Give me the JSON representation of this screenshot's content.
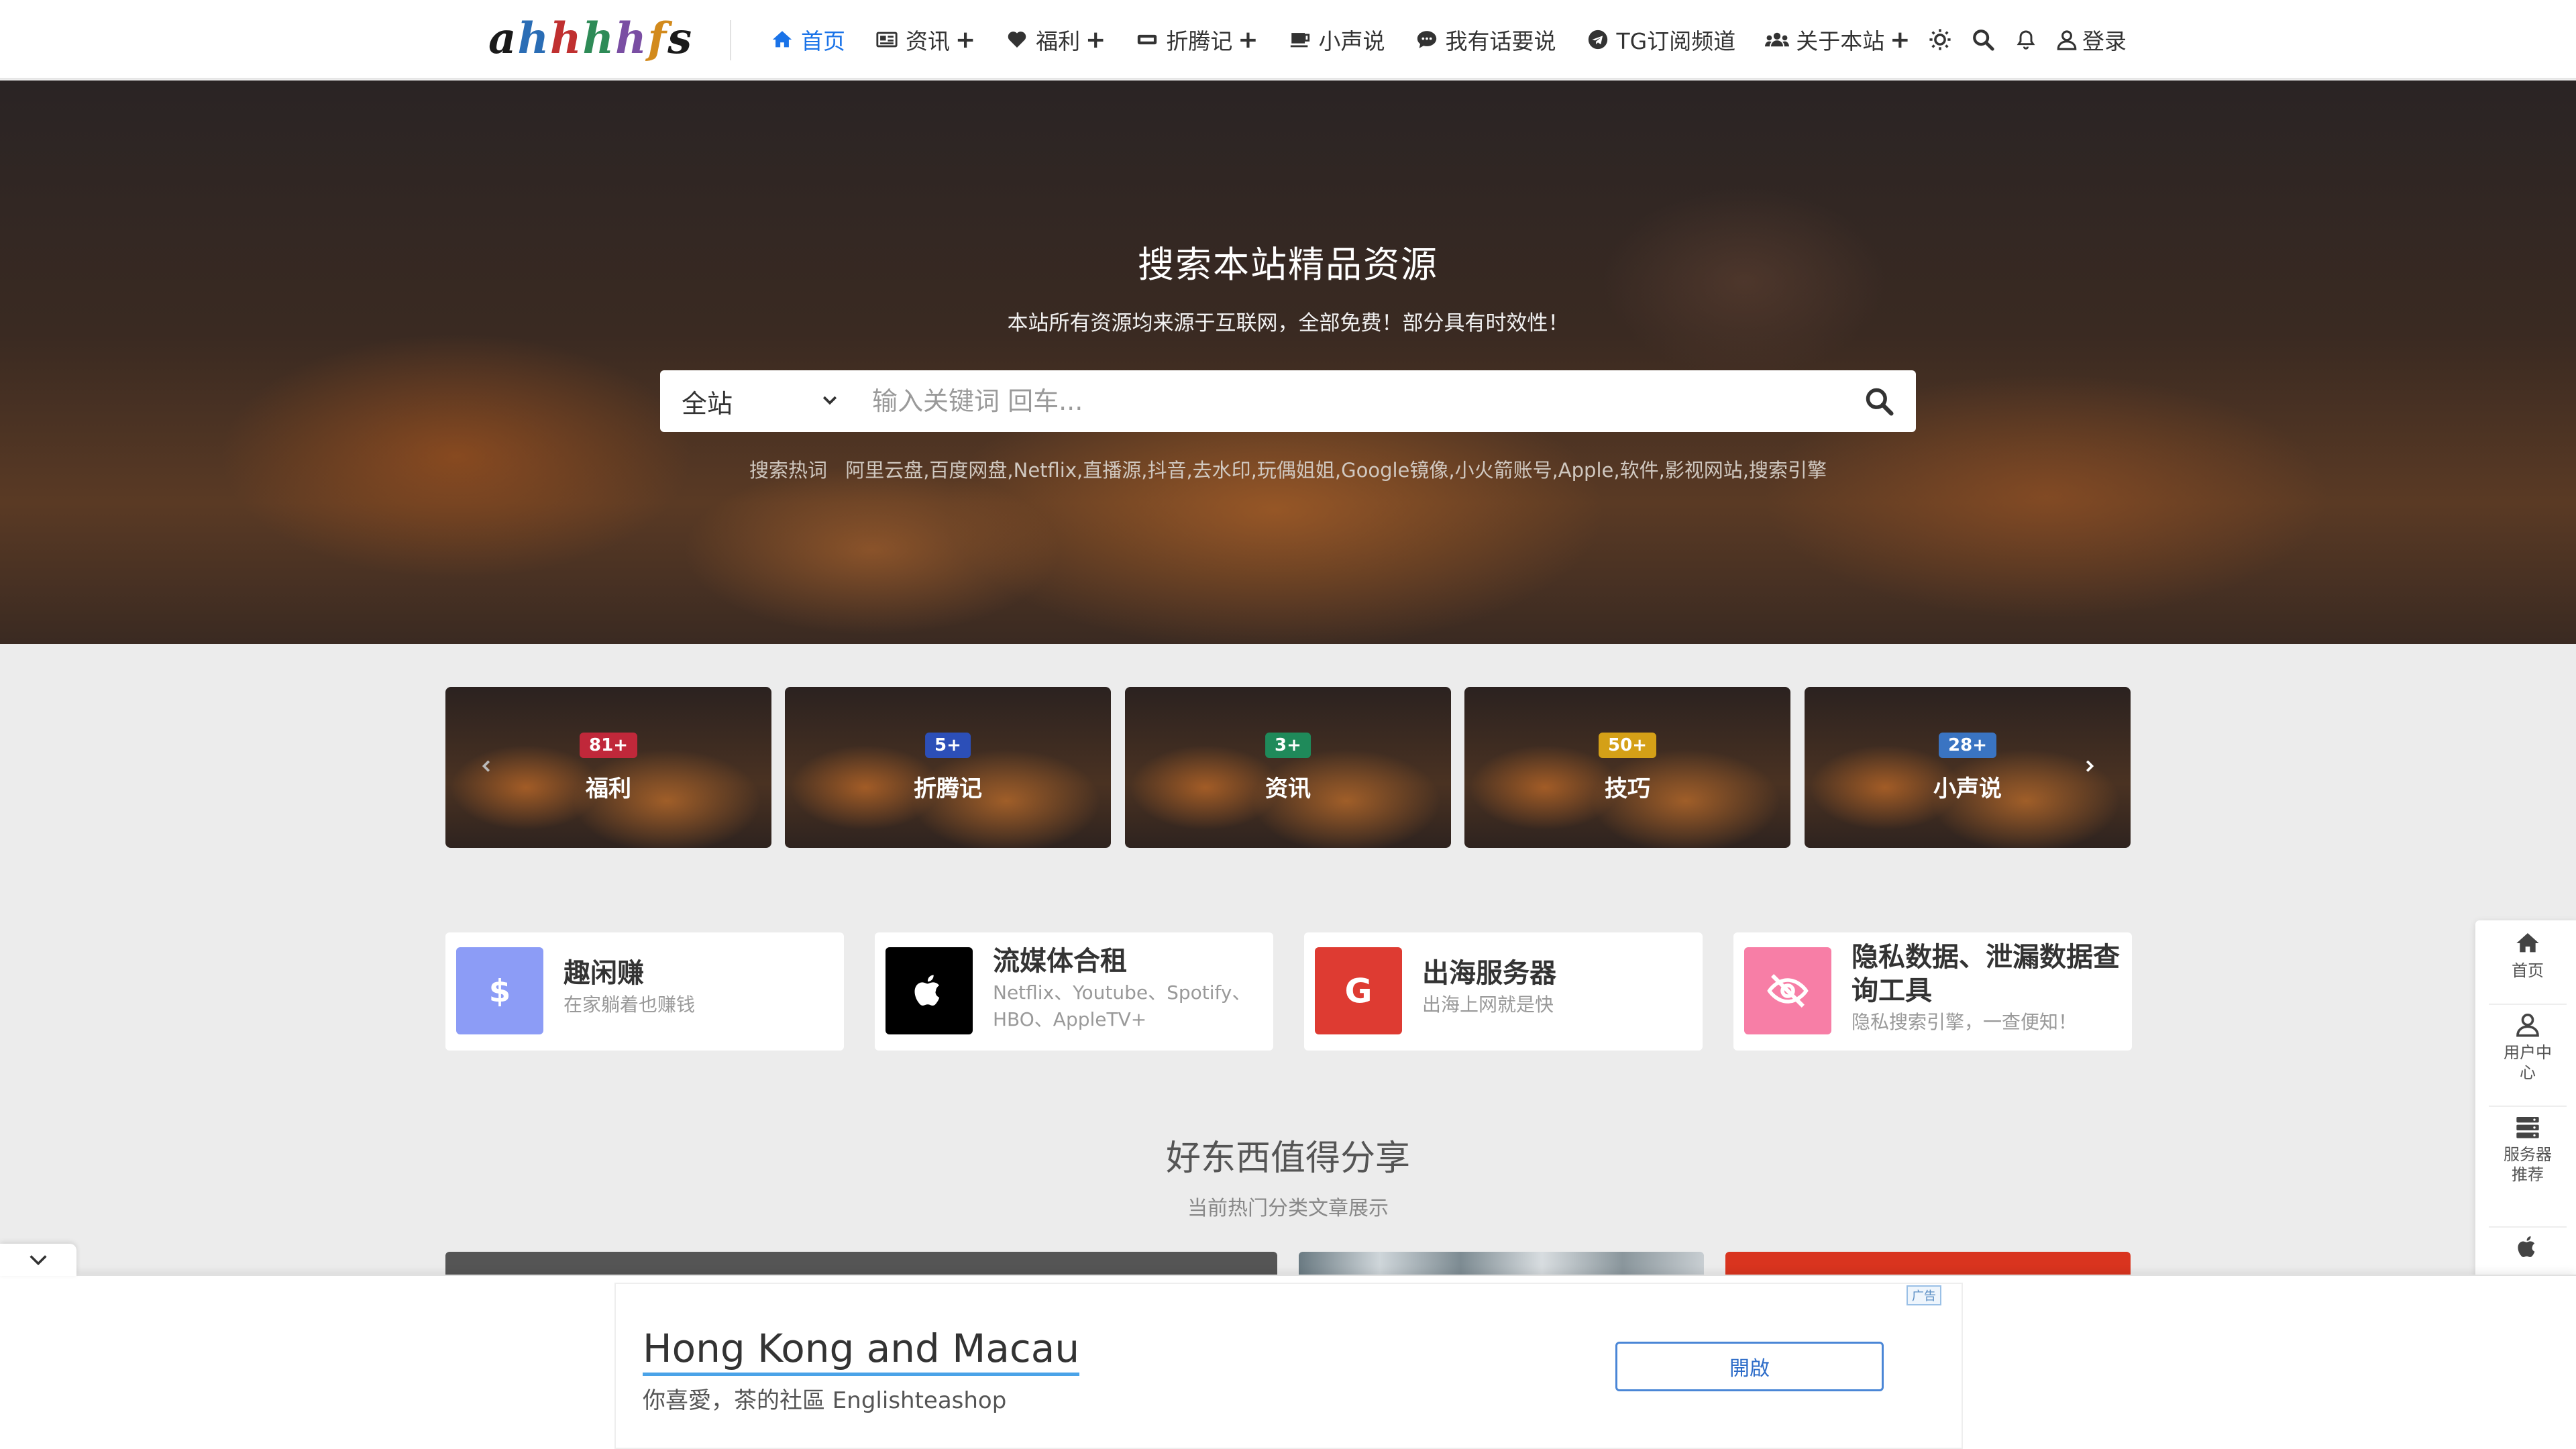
{
  "header": {
    "logo_letters": [
      "a",
      "h",
      "h",
      "h",
      "h",
      "f",
      "s"
    ],
    "logo_colors": [
      "#1a1a1a",
      "#2a6db5",
      "#c03030",
      "#2e8b57",
      "#7a4ea3",
      "#d28a1c",
      "#1a1a1a"
    ],
    "nav": [
      {
        "label": "首页",
        "icon": "home-icon",
        "plus": ""
      },
      {
        "label": "资讯",
        "icon": "newspaper-icon",
        "plus": "+"
      },
      {
        "label": "福利",
        "icon": "heart-icon",
        "plus": "+"
      },
      {
        "label": "折腾记",
        "icon": "ticket-icon",
        "plus": "+"
      },
      {
        "label": "小声说",
        "icon": "mug-icon",
        "plus": ""
      },
      {
        "label": "我有话要说",
        "icon": "comment-icon",
        "plus": ""
      },
      {
        "label": "TG订阅频道",
        "icon": "telegram-icon",
        "plus": ""
      },
      {
        "label": "关于本站",
        "icon": "users-icon",
        "plus": "+"
      }
    ],
    "login_label": "登录"
  },
  "hero": {
    "title": "搜索本站精品资源",
    "subtitle": "本站所有资源均来源于互联网，全部免费！部分具有时效性！",
    "search_scope": "全站",
    "search_placeholder": "输入关键词 回车...",
    "hot_label": "搜索热词",
    "hot_words": "阿里云盘,百度网盘,Netflix,直播源,抖音,去水印,玩偶姐姐,Google镜像,小火箭账号,Apple,软件,影视网站,搜索引擎"
  },
  "categories": [
    {
      "name": "福利",
      "count": "81+",
      "badge_color": "#c0283a"
    },
    {
      "name": "折腾记",
      "count": "5+",
      "badge_color": "#2c4fb8"
    },
    {
      "name": "资讯",
      "count": "3+",
      "badge_color": "#1f8a5a"
    },
    {
      "name": "技巧",
      "count": "50+",
      "badge_color": "#d4a017"
    },
    {
      "name": "小声说",
      "count": "28+",
      "badge_color": "#3a74c2"
    }
  ],
  "services": [
    {
      "title": "趣闲赚",
      "desc": "在家躺着也赚钱",
      "icon": "dollar-icon",
      "color": "#8c9cf6"
    },
    {
      "title": "流媒体合租",
      "desc": "Netflix、Youtube、Spotify、HBO、AppleTV+",
      "icon": "apple-icon",
      "color": "#000000"
    },
    {
      "title": "出海服务器",
      "desc": "出海上网就是快",
      "icon": "google-icon",
      "color": "#de3b32"
    },
    {
      "title": "隐私数据、泄漏数据查询工具",
      "desc": "隐私搜索引擎，一查便知！",
      "icon": "eye-slash-icon",
      "color": "#f77ea6"
    }
  ],
  "section": {
    "title": "好东西值得分享",
    "subtitle": "当前热门分类文章展示"
  },
  "float_bar": {
    "home": "首页",
    "user": "用户中心",
    "server": "服务器推荐"
  },
  "ad": {
    "label": "广告",
    "headline": "Hong Kong and Macau",
    "desc": "你喜愛，茶的社區 Englishteashop",
    "button": "開啟"
  }
}
